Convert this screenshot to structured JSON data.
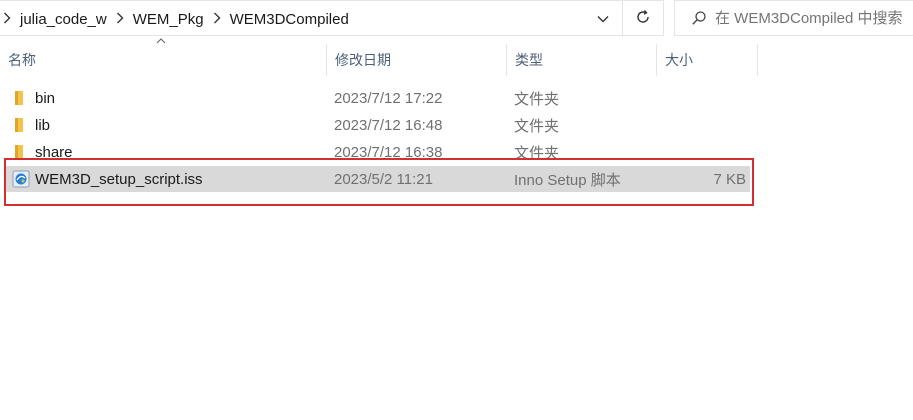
{
  "address_bar": {
    "breadcrumbs": [
      "julia_code_w",
      "WEM_Pkg",
      "WEM3DCompiled"
    ]
  },
  "search": {
    "placeholder": "在 WEM3DCompiled 中搜索"
  },
  "columns": {
    "name": "名称",
    "date": "修改日期",
    "type": "类型",
    "size": "大小"
  },
  "files": [
    {
      "name": "bin",
      "date": "2023/7/12 17:22",
      "type": "文件夹",
      "size": "",
      "icon": "folder-icon"
    },
    {
      "name": "lib",
      "date": "2023/7/12 16:48",
      "type": "文件夹",
      "size": "",
      "icon": "folder-icon"
    },
    {
      "name": "share",
      "date": "2023/7/12 16:38",
      "type": "文件夹",
      "size": "",
      "icon": "folder-icon"
    },
    {
      "name": "WEM3D_setup_script.iss",
      "date": "2023/5/2 11:21",
      "type": "Inno Setup 脚本",
      "size": "7 KB",
      "icon": "inno-setup-file-icon",
      "selected": true
    }
  ],
  "colors": {
    "highlight_border": "#d32f2f",
    "selected_row": "#d9d9d9",
    "folder": "#f3c34a",
    "header_text": "#4c607a"
  }
}
